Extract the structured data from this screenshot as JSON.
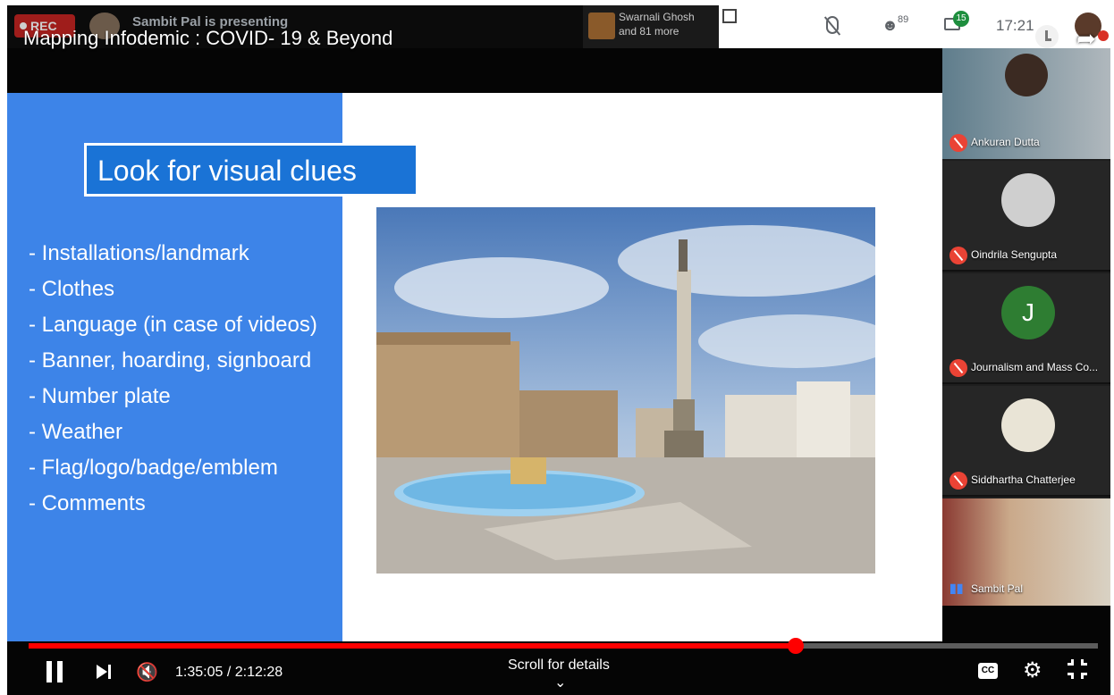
{
  "meet": {
    "rec_label": "REC",
    "presenting_text": "Sambit Pal is presenting",
    "viewer_name": "Swarnali Ghosh",
    "viewer_more": "and 81 more",
    "participant_count": "89",
    "chat_count": "15",
    "clock": "17:21"
  },
  "video": {
    "title": "Mapping Infodemic : COVID- 19 & Beyond"
  },
  "slide": {
    "heading": "Look for visual clues",
    "bullets": [
      "- Installations/landmark",
      "- Clothes",
      "- Language (in case of videos)",
      "- Banner, hoarding, signboard",
      "- Number plate",
      "- Weather",
      "- Flag/logo/badge/emblem",
      "- Comments"
    ]
  },
  "participants": [
    {
      "name": "Ankuran Dutta",
      "muted": true
    },
    {
      "name": "Oindrila Sengupta",
      "muted": true
    },
    {
      "name": "Journalism and Mass Co...",
      "muted": true,
      "initial": "J"
    },
    {
      "name": "Siddhartha Chatterjee",
      "muted": true
    },
    {
      "name": "Sambit Pal",
      "muted": false
    }
  ],
  "player": {
    "current_time": "1:35:05",
    "separator": " / ",
    "duration": "2:12:28",
    "time_display": "1:35:05 / 2:12:28",
    "progress_fraction": 0.7178,
    "scroll_hint": "Scroll for details",
    "cc_label": "CC"
  },
  "colors": {
    "accent_red": "#ff0000",
    "slide_blue": "#3d84e8",
    "mute_red": "#ea4335"
  }
}
